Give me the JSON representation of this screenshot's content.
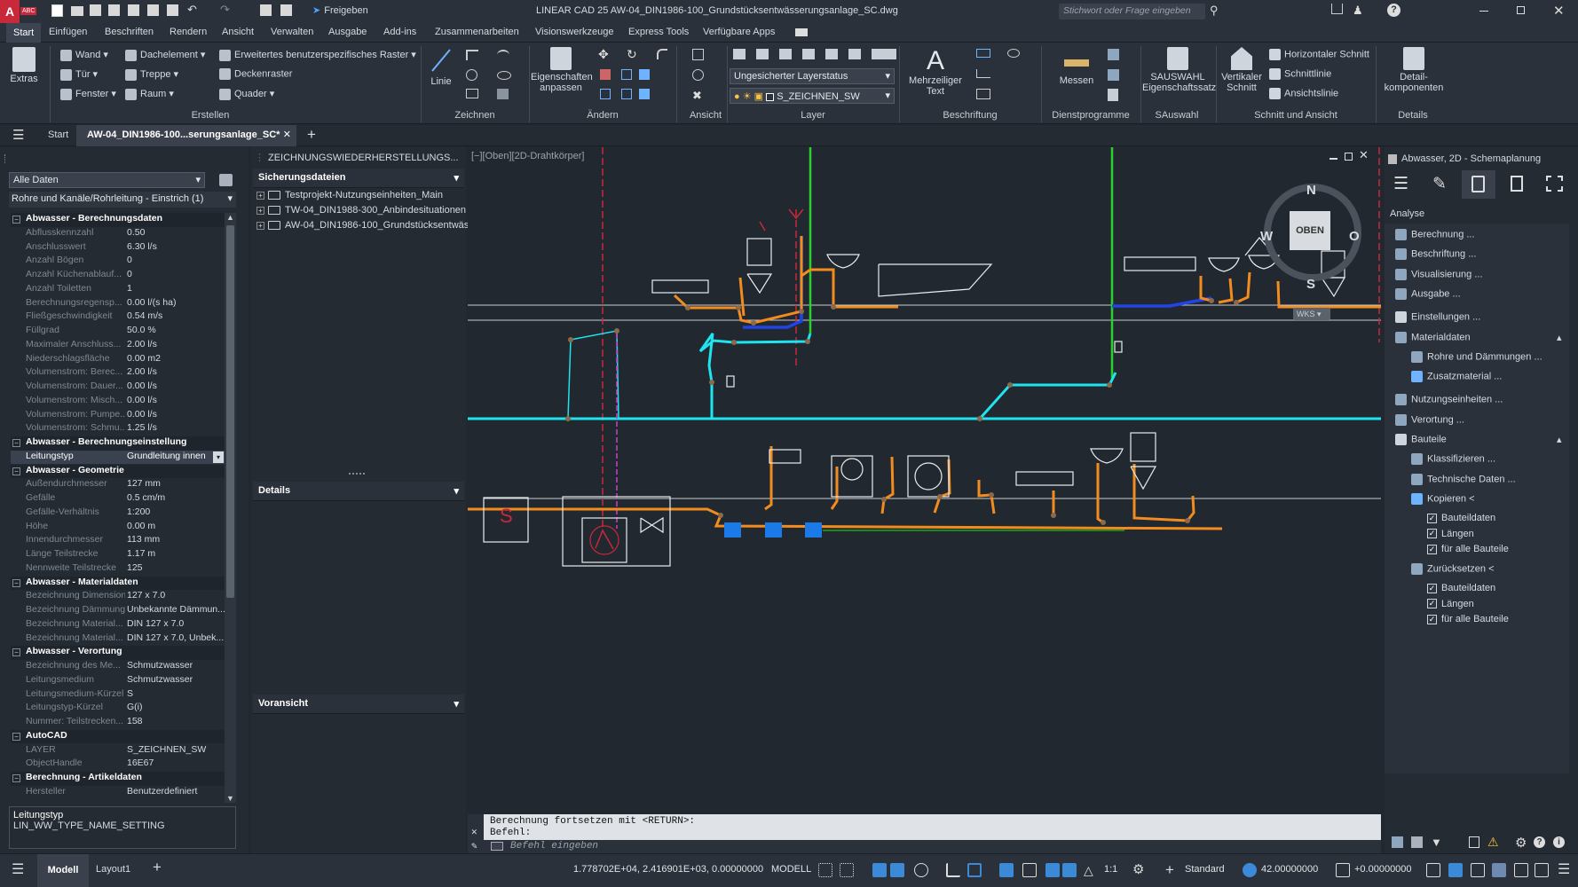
{
  "app": {
    "logo_text": "A",
    "logo_sub": "ABC",
    "share_label": "Freigeben",
    "title": "LINEAR CAD 25   AW-04_DIN1986-100_Grundstücksentwässerungsanlage_SC.dwg",
    "search_placeholder": "Stichwort oder Frage eingeben",
    "accent": "#c9283b"
  },
  "menu": [
    "Start",
    "Einfügen",
    "Beschriften",
    "Rendern",
    "Ansicht",
    "Verwalten",
    "Ausgabe",
    "Add-ins",
    "Zusammenarbeiten",
    "Visionswerkzeuge",
    "Express Tools",
    "Verfügbare Apps"
  ],
  "ribbon": {
    "extras": "Extras",
    "wand": "Wand",
    "tuer": "Tür",
    "fenster": "Fenster",
    "dachelement": "Dachelement",
    "treppe": "Treppe",
    "raum": "Raum",
    "raster": "Erweitertes benutzerspezifisches Raster",
    "deckenraster": "Deckenraster",
    "quader": "Quader",
    "linie": "Linie",
    "eigenschaften": "Eigenschaften anpassen",
    "layerstatus": "Ungesicherter Layerstatus",
    "layer_current": "S_ZEICHNEN_SW",
    "mtext": "Mehrzeiliger Text",
    "messen": "Messen",
    "sauswahl": "SAUSWAHL Eigenschaftssatz",
    "vert_schnitt": "Vertikaler Schnitt",
    "hor_schnitt": "Horizontaler Schnitt",
    "schnittlinie": "Schnittlinie",
    "ansichtslinie": "Ansichtslinie",
    "detail": "Detail- komponenten",
    "groups": {
      "erstellen": "Erstellen",
      "zeichnen": "Zeichnen",
      "aendern": "Ändern",
      "ansicht": "Ansicht",
      "layer": "Layer",
      "beschriftung": "Beschriftung",
      "dienst": "Dienstprogramme",
      "sauswahl": "SAuswahl",
      "schnitt": "Schnitt und Ansicht",
      "details": "Details"
    }
  },
  "tabs": {
    "start": "Start",
    "doc": "AW-04_DIN1986-100...serungsanlage_SC*"
  },
  "props": {
    "filter": "Alle Daten",
    "object": "Rohre und Kanäle/Rohrleitung - Einstrich (1)",
    "rows": [
      {
        "t": "sec",
        "k": "Abwasser - Berechnungsdaten"
      },
      {
        "k": "Abflusskennzahl",
        "v": "0.50"
      },
      {
        "k": "Anschlusswert",
        "v": "6.30 l/s"
      },
      {
        "k": "Anzahl Bögen",
        "v": "0"
      },
      {
        "k": "Anzahl Küchenablauf...",
        "v": "0"
      },
      {
        "k": "Anzahl Toiletten",
        "v": "1"
      },
      {
        "k": "Berechnungsregensp...",
        "v": "0.00 l/(s ha)"
      },
      {
        "k": "Fließgeschwindigkeit",
        "v": "0.54 m/s"
      },
      {
        "k": "Füllgrad",
        "v": "50.0 %"
      },
      {
        "k": "Maximaler Anschluss...",
        "v": "2.00 l/s"
      },
      {
        "k": "Niederschlagsfläche",
        "v": "0.00 m2"
      },
      {
        "k": "Volumenstrom: Berec...",
        "v": "2.00 l/s"
      },
      {
        "k": "Volumenstrom: Dauer...",
        "v": "0.00 l/s"
      },
      {
        "k": "Volumenstrom: Misch...",
        "v": "0.00 l/s"
      },
      {
        "k": "Volumenstrom: Pumpe...",
        "v": "0.00 l/s"
      },
      {
        "k": "Volumenstrom: Schmu...",
        "v": "1.25 l/s"
      },
      {
        "t": "sec",
        "k": "Abwasser - Berechnungseinstellung"
      },
      {
        "t": "hl",
        "k": "Leitungstyp",
        "v": "Grundleitung innen"
      },
      {
        "t": "sec",
        "k": "Abwasser - Geometrie"
      },
      {
        "k": "Außendurchmesser",
        "v": "127 mm"
      },
      {
        "k": "Gefälle",
        "v": "0.5 cm/m"
      },
      {
        "k": "Gefälle-Verhältnis",
        "v": "1:200"
      },
      {
        "k": "Höhe",
        "v": "0.00 m"
      },
      {
        "k": "Innendurchmesser",
        "v": "113 mm"
      },
      {
        "k": "Länge Teilstrecke",
        "v": "1.17 m"
      },
      {
        "k": "Nennweite Teilstrecke",
        "v": "125"
      },
      {
        "t": "sec",
        "k": "Abwasser - Materialdaten"
      },
      {
        "k": "Bezeichnung Dimension",
        "v": "127 x 7.0"
      },
      {
        "k": "Bezeichnung Dämmung",
        "v": "Unbekannte Dämmun..."
      },
      {
        "k": "Bezeichnung Material...",
        "v": "DIN 127 x 7.0"
      },
      {
        "k": "Bezeichnung Material...",
        "v": "DIN 127 x 7.0, Unbek..."
      },
      {
        "t": "sec",
        "k": "Abwasser - Verortung"
      },
      {
        "k": "Bezeichnung des Me...",
        "v": "Schmutzwasser"
      },
      {
        "k": "Leitungsmedium",
        "v": "Schmutzwasser"
      },
      {
        "k": "Leitungsmedium-Kürzel",
        "v": "S"
      },
      {
        "k": "Leitungstyp-Kürzel",
        "v": "G(i)"
      },
      {
        "k": "Nummer: Teilstrecken...",
        "v": "158"
      },
      {
        "t": "sec",
        "k": "AutoCAD"
      },
      {
        "k": "LAYER",
        "v": "S_ZEICHNEN_SW"
      },
      {
        "k": "ObjectHandle",
        "v": "16E67"
      },
      {
        "t": "sec",
        "k": "Berechnung - Artikeldaten"
      },
      {
        "k": "Hersteller",
        "v": "Benutzerdefiniert"
      }
    ],
    "desc_title": "Leitungstyp",
    "desc_text": "LIN_WW_TYPE_NAME_SETTING"
  },
  "recovery": {
    "title": "ZEICHNUNGSWIEDERHERSTELLUNGS...",
    "backup_header": "Sicherungsdateien",
    "files": [
      "Testprojekt-Nutzungseinheiten_Main",
      "TW-04_DIN1988-300_Anbindesituationen",
      "AW-04_DIN1986-100_Grundstücksentwäs"
    ],
    "details": "Details",
    "preview": "Voransicht"
  },
  "viewport": {
    "label": "[−][Oben][2D-Drahtkörper]",
    "cube_n": "N",
    "cube_s": "S",
    "cube_w": "W",
    "cube_o": "O",
    "cube_top": "OBEN",
    "wks": "WKS",
    "symbol_s": "S"
  },
  "command": {
    "line1": "Berechnung fortsetzen mit <RETURN>:",
    "line2": "Befehl:",
    "placeholder": "Befehl eingeben"
  },
  "analysis": {
    "title": "Abwasser, 2D - Schemaplanung",
    "section": "Analyse",
    "items": [
      {
        "l": "Berechnung ...",
        "lv": 0
      },
      {
        "l": "Beschriftung ...",
        "lv": 0
      },
      {
        "l": "Visualisierung ...",
        "lv": 0
      },
      {
        "l": "Ausgabe ...",
        "lv": 0
      },
      {
        "l": "Einstellungen ...",
        "lv": 0,
        "gap": true
      },
      {
        "l": "Materialdaten",
        "lv": 0,
        "exp": true
      },
      {
        "l": "Rohre und Dämmungen ...",
        "lv": 1
      },
      {
        "l": "Zusatzmaterial ...",
        "lv": 1
      },
      {
        "l": "Nutzungseinheiten ...",
        "lv": 0,
        "gap": true
      },
      {
        "l": "Verortung ...",
        "lv": 0
      },
      {
        "l": "Bauteile",
        "lv": 0,
        "exp": true
      },
      {
        "l": "Klassifizieren ...",
        "lv": 1
      },
      {
        "l": "Technische Daten ...",
        "lv": 1
      },
      {
        "l": "Kopieren <",
        "lv": 1
      },
      {
        "l": "Bauteildaten",
        "lv": 2
      },
      {
        "l": "Längen",
        "lv": 2
      },
      {
        "l": "für alle Bauteile",
        "lv": 2
      },
      {
        "l": "Zurücksetzen <",
        "lv": 1,
        "gap": true
      },
      {
        "l": "Bauteildaten",
        "lv": 2
      },
      {
        "l": "Längen",
        "lv": 2
      },
      {
        "l": "für alle Bauteile",
        "lv": 2
      }
    ]
  },
  "status": {
    "model_tab": "Modell",
    "layout_tab": "Layout1",
    "coords": "1.778702E+04, 2.416901E+03, 0.00000000",
    "mode": "MODELL",
    "scale": "1:1",
    "style": "Standard",
    "elev": "42.00000000",
    "offset": "+0.00000000"
  }
}
